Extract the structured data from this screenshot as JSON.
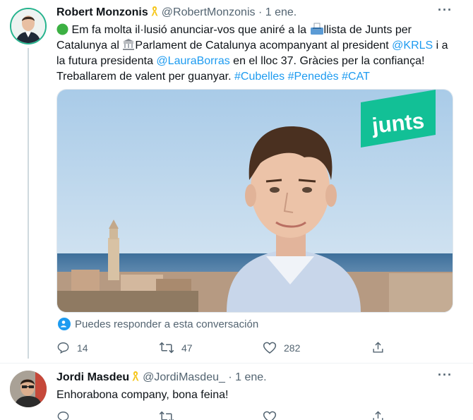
{
  "tweets": [
    {
      "author_name": "Robert Monzonis",
      "handle": "@RobertMonzonis",
      "separator": "·",
      "date": "1 ene.",
      "text": {
        "p1": " Em fa molta il·lusió anunciar-vos que aniré a la ",
        "p2": "llista de Junts per Catalunya al ",
        "p3": "Parlament de Catalunya acompanyant al president ",
        "mention1": "@KRLS",
        "p4": " i a la futura presidenta ",
        "mention2": "@LauraBorras",
        "p5": " en el lloc 37. Gràcies per la confiança! Treballarem de valent per guanyar. ",
        "tag1": "#Cubelles",
        "tag2": "#Penedès",
        "tag3": "#CAT"
      },
      "media_logo": "junts",
      "reply_notice": "Puedes responder a esta conversación",
      "actions": {
        "replies": "14",
        "retweets": "47",
        "likes": "282"
      }
    },
    {
      "author_name": "Jordi Masdeu",
      "handle": "@JordiMasdeu_",
      "separator": "·",
      "date": "1 ene.",
      "text": "Enhorabona company, bona feina!"
    }
  ],
  "colors": {
    "link": "#1d9bf0",
    "muted": "#536471",
    "junts_green": "#12c096",
    "ribbon": "#f5c518"
  },
  "icons": [
    "more-icon",
    "ribbon-icon",
    "green-circle-emoji",
    "ballot-box-emoji",
    "classical-building-emoji",
    "people-icon",
    "reply-icon",
    "retweet-icon",
    "like-icon",
    "share-icon"
  ]
}
